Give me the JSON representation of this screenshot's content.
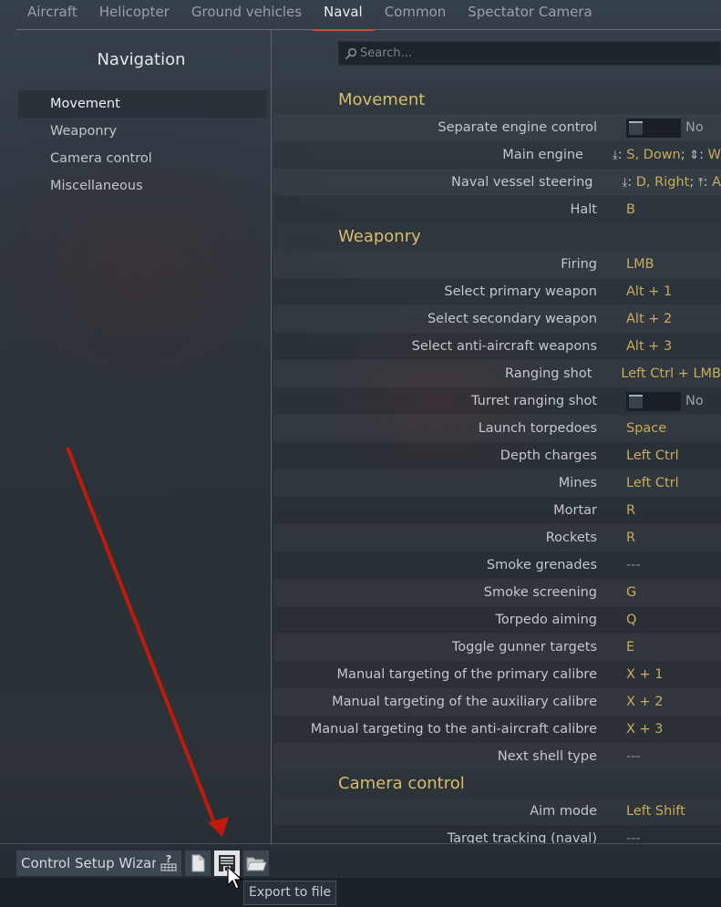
{
  "tabs": [
    {
      "label": "Aircraft",
      "active": false
    },
    {
      "label": "Helicopter",
      "active": false
    },
    {
      "label": "Ground vehicles",
      "active": false
    },
    {
      "label": "Naval",
      "active": true
    },
    {
      "label": "Common",
      "active": false
    },
    {
      "label": "Spectator Camera",
      "active": false
    }
  ],
  "navigation": {
    "title": "Navigation",
    "items": [
      {
        "label": "Movement",
        "active": true
      },
      {
        "label": "Weaponry",
        "active": false
      },
      {
        "label": "Camera control",
        "active": false
      },
      {
        "label": "Miscellaneous",
        "active": false
      }
    ]
  },
  "search": {
    "placeholder": "Search...",
    "value": "",
    "icon": "magnifier-icon"
  },
  "sections": {
    "movement": {
      "title": "Movement",
      "rows": {
        "separate_engine": {
          "label": "Separate engine control",
          "toggle": "No"
        },
        "main_engine": {
          "label": "Main engine",
          "axis_down": "⤓",
          "down_keys": "S, Down",
          "sep": ";",
          "axis_both": "⇕",
          "up_keys": "W"
        },
        "steering": {
          "label": "Naval vessel steering",
          "axis_down": "⤓",
          "right_keys": "D, Right",
          "sep": ";",
          "axis_up": "⤒",
          "left_keys": "A"
        },
        "halt": {
          "label": "Halt",
          "value": "B"
        }
      }
    },
    "weaponry": {
      "title": "Weaponry",
      "rows": [
        {
          "label": "Firing",
          "value": "LMB"
        },
        {
          "label": "Select primary weapon",
          "value": "Alt + 1"
        },
        {
          "label": "Select secondary weapon",
          "value": "Alt + 2"
        },
        {
          "label": "Select anti-aircraft weapons",
          "value": "Alt + 3"
        },
        {
          "label": "Ranging shot",
          "value": "Left Ctrl + LMB"
        },
        {
          "label": "Turret ranging shot",
          "toggle": "No"
        },
        {
          "label": "Launch torpedoes",
          "value": "Space"
        },
        {
          "label": "Depth charges",
          "value": "Left Ctrl"
        },
        {
          "label": "Mines",
          "value": "Left Ctrl"
        },
        {
          "label": "Mortar",
          "value": "R"
        },
        {
          "label": "Rockets",
          "value": "R"
        },
        {
          "label": "Smoke grenades",
          "value": "---"
        },
        {
          "label": "Smoke screening",
          "value": "G"
        },
        {
          "label": "Torpedo aiming",
          "value": "Q"
        },
        {
          "label": "Toggle gunner targets",
          "value": "E"
        },
        {
          "label": "Manual targeting of the primary calibre",
          "value": "X + 1"
        },
        {
          "label": "Manual targeting of the auxiliary calibre",
          "value": "X + 2"
        },
        {
          "label": "Manual targeting to the anti-aircraft calibre",
          "value": "X + 3"
        },
        {
          "label": "Next shell type",
          "value": "---"
        }
      ]
    },
    "camera": {
      "title": "Camera control",
      "rows": [
        {
          "label": "Aim mode",
          "value": "Left Shift"
        },
        {
          "label": "Target tracking (naval)",
          "value": "---"
        }
      ]
    }
  },
  "bottom_bar": {
    "wizard_label": "Control Setup Wizard",
    "buttons": [
      {
        "icon": "keyboard-help-icon"
      },
      {
        "icon": "new-file-icon"
      },
      {
        "icon": "floppy-save-icon",
        "hovered": true
      },
      {
        "icon": "open-folder-icon"
      }
    ],
    "tooltip": "Export to file"
  },
  "colors": {
    "accent_tab_underline": "#c4513f",
    "section_heading": "#d8bc6c",
    "key_value": "#c9ac5c",
    "annotation_arrow": "#c01a0c"
  }
}
